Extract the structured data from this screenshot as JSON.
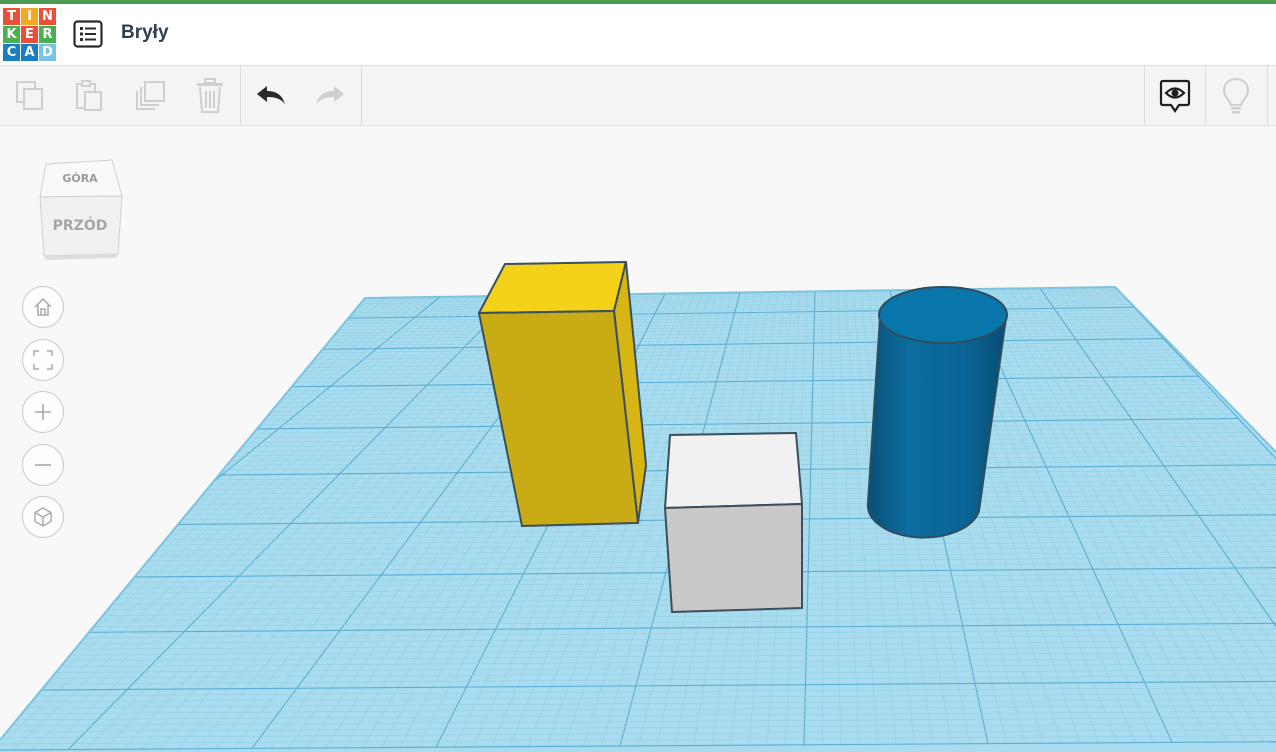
{
  "app": {
    "logo_letters": [
      "T",
      "I",
      "N",
      "K",
      "E",
      "R",
      "C",
      "A",
      "D"
    ],
    "logo_colors": [
      "#e8503a",
      "#f5a623",
      "#e8503a",
      "#4caf50",
      "#e8503a",
      "#4caf50",
      "#1a7fc1",
      "#1a7fc1",
      "#7bc2e7"
    ],
    "accent_color": "#4b9b53"
  },
  "header": {
    "menu_icon": "list-icon",
    "title": "Bryły"
  },
  "toolbar": {
    "left_buttons": [
      {
        "name": "copy",
        "icon": "copy-icon",
        "enabled": false
      },
      {
        "name": "paste",
        "icon": "paste-icon",
        "enabled": false
      },
      {
        "name": "duplicate",
        "icon": "duplicate-icon",
        "enabled": false
      },
      {
        "name": "delete",
        "icon": "trash-icon",
        "enabled": false
      },
      {
        "name": "undo",
        "icon": "undo-icon",
        "enabled": true
      },
      {
        "name": "redo",
        "icon": "redo-icon",
        "enabled": false
      }
    ],
    "right_buttons": [
      {
        "name": "show-all",
        "icon": "eye-icon",
        "enabled": true
      },
      {
        "name": "hint",
        "icon": "lightbulb-icon",
        "enabled": false
      }
    ]
  },
  "viewcube": {
    "top_label": "GÓRA",
    "front_label": "PRZÓD"
  },
  "nav_controls": [
    {
      "name": "home-view",
      "icon": "home-icon"
    },
    {
      "name": "fit-view",
      "icon": "fit-icon"
    },
    {
      "name": "zoom-in",
      "icon": "plus-icon"
    },
    {
      "name": "zoom-out",
      "icon": "minus-icon"
    },
    {
      "name": "ortho-view",
      "icon": "cube-icon"
    }
  ],
  "scene": {
    "workplane_color": "#9fd6ea",
    "grid_color": "#5fb7d8",
    "shapes": [
      {
        "name": "box-yellow",
        "type": "box",
        "color": "#d9b61a"
      },
      {
        "name": "cube-white",
        "type": "box",
        "color": "#e8e8e8"
      },
      {
        "name": "cylinder-blue",
        "type": "cylinder",
        "color": "#0c6d9e"
      }
    ]
  }
}
